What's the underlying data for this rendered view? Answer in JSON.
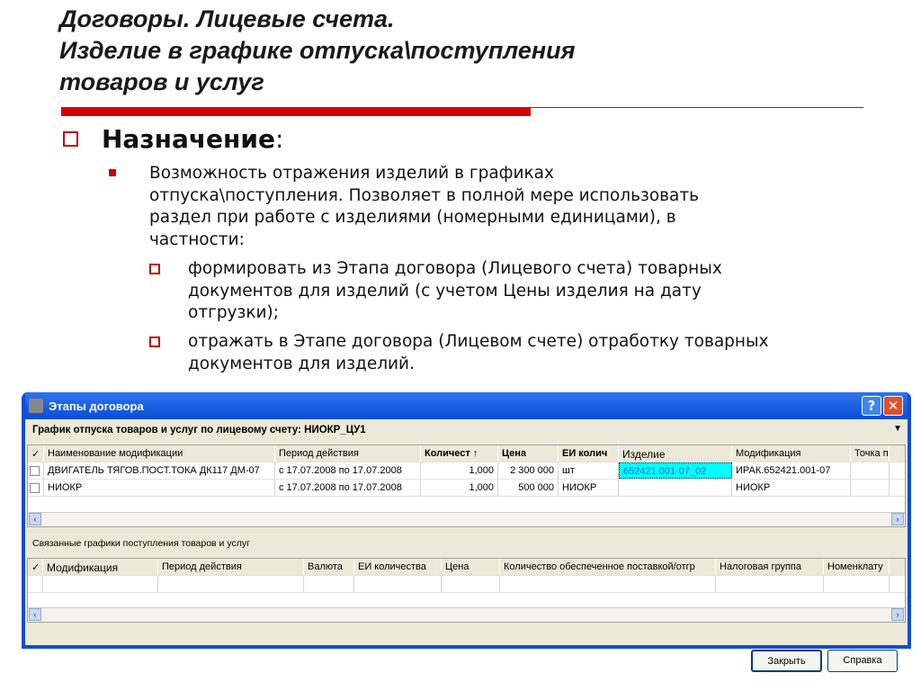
{
  "slide": {
    "title_lines": [
      "Договоры. Лицевые счета.",
      "Изделие в графике отпуска\\поступления",
      "товаров и услуг"
    ],
    "heading": "Назначение",
    "heading_colon": ":",
    "para": [
      "Возможность отражения изделий в графиках",
      "отпуска\\поступления. Позволяет в полной мере использовать",
      "раздел при работе с изделиями (номерными единицами), в",
      "частности:"
    ],
    "sub1": [
      "формировать из Этапа договора (Лицевого счета) товарных",
      "документов для изделий (с учетом Цены изделия на дату",
      "отгрузки);"
    ],
    "sub2": [
      "отражать в Этапе договора (Лицевом счете) отработку товарных",
      "документов для изделий."
    ]
  },
  "window": {
    "title": "Этапы договора",
    "help": "?",
    "close": "✕",
    "header": "График отпуска товаров и услуг по лицевому счету: НИОКР_ЦУ1",
    "filter_icon": "▼",
    "top_columns": [
      "✓",
      "Наименование модификации",
      "Период действия",
      "Количест ↑",
      "Цена",
      "ЕИ колич",
      "Изделие",
      "Модификация",
      "Точка п"
    ],
    "top_rows": [
      [
        "ДВИГАТЕЛЬ ТЯГОВ.ПОСТ.ТОКА ДК117 ДМ-07",
        "с 17.07.2008 по 17.07.2008",
        "1,000",
        "2 300 000",
        "шт",
        "652421.001-07_02",
        "ИРАК.652421.001-07",
        ""
      ],
      [
        "НИОКР",
        "с 17.07.2008 по 17.07.2008",
        "1,000",
        "500 000",
        "НИОКР",
        "",
        "НИОКР",
        ""
      ]
    ],
    "section2": "Связанные графики поступления товаров и услуг",
    "bottom_columns": [
      "✓",
      "Модификация",
      "Период действия",
      "Валюта",
      "ЕИ количества",
      "Цена",
      "Количество обеспеченное поставкой/отгр",
      "Налоговая группа",
      "Номенклату"
    ],
    "close_btn": "Закрыть",
    "help_btn": "Справка"
  },
  "colors": {
    "accent": "#d40000",
    "highlight": "#00ffff",
    "titlebar": "#0a4ed8"
  }
}
